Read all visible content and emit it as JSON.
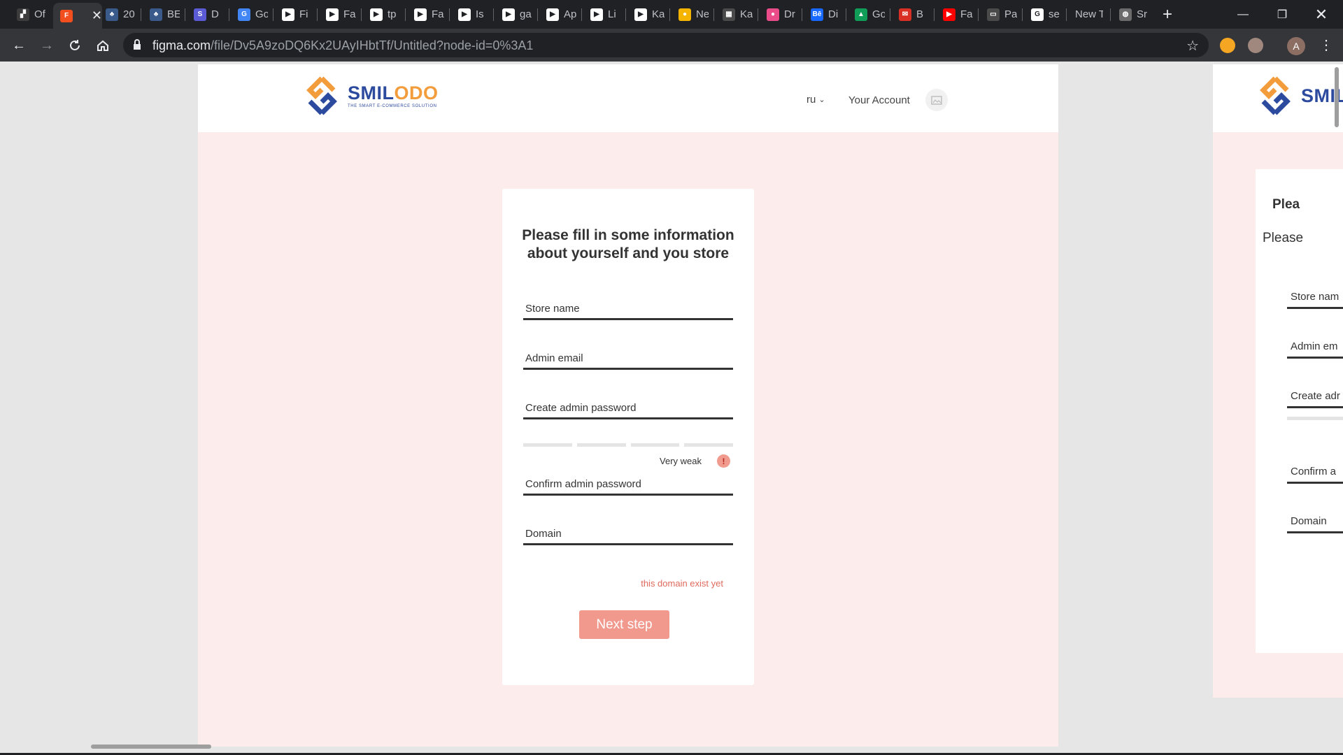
{
  "browser": {
    "tabs": [
      {
        "title": "Of",
        "fav_color": "#3c3c3c",
        "fav_glyph": "▞"
      },
      {
        "title": "",
        "fav_color": "#f24e1e",
        "fav_glyph": "F",
        "active": true
      },
      {
        "title": "20",
        "fav_color": "#3a5a8c",
        "fav_glyph": "♣"
      },
      {
        "title": "BE",
        "fav_color": "#3a5a8c",
        "fav_glyph": "♣"
      },
      {
        "title": "D",
        "fav_color": "#5b5bd6",
        "fav_glyph": "S"
      },
      {
        "title": "Go",
        "fav_color": "#4285f4",
        "fav_glyph": "G"
      },
      {
        "title": "Fi",
        "fav_color": "#ffffff",
        "fav_glyph": "▶"
      },
      {
        "title": "Fa",
        "fav_color": "#ffffff",
        "fav_glyph": "▶"
      },
      {
        "title": "tp",
        "fav_color": "#ffffff",
        "fav_glyph": "▶"
      },
      {
        "title": "Fa",
        "fav_color": "#ffffff",
        "fav_glyph": "▶"
      },
      {
        "title": "Is",
        "fav_color": "#ffffff",
        "fav_glyph": "▶"
      },
      {
        "title": "ga",
        "fav_color": "#ffffff",
        "fav_glyph": "▶"
      },
      {
        "title": "Ap",
        "fav_color": "#ffffff",
        "fav_glyph": "▶"
      },
      {
        "title": "Li",
        "fav_color": "#ffffff",
        "fav_glyph": "▶"
      },
      {
        "title": "Ka",
        "fav_color": "#ffffff",
        "fav_glyph": "▶"
      },
      {
        "title": "Ne",
        "fav_color": "#f4b400",
        "fav_glyph": "●"
      },
      {
        "title": "Ka",
        "fav_color": "#4a4a4a",
        "fav_glyph": "▦"
      },
      {
        "title": "Dr",
        "fav_color": "#ea4c89",
        "fav_glyph": "●"
      },
      {
        "title": "Di",
        "fav_color": "#1769ff",
        "fav_glyph": "Bē"
      },
      {
        "title": "Go",
        "fav_color": "#0f9d58",
        "fav_glyph": "▲"
      },
      {
        "title": "B",
        "fav_color": "#d93025",
        "fav_glyph": "✉"
      },
      {
        "title": "Fa",
        "fav_color": "#ff0000",
        "fav_glyph": "▶"
      },
      {
        "title": "Pa",
        "fav_color": "#4a4a4a",
        "fav_glyph": "▭"
      },
      {
        "title": "se",
        "fav_color": "#ffffff",
        "fav_glyph": "G"
      },
      {
        "title": "New T",
        "fav_color": "",
        "fav_glyph": ""
      },
      {
        "title": "Sr",
        "fav_color": "#6b6b6b",
        "fav_glyph": "◍"
      }
    ],
    "url_host": "figma.com",
    "url_path": "/file/Dv5A9zoDQ6Kx2UAyIHbtTf/Untitled?node-id=0%3A1",
    "profile_initial": "A"
  },
  "site": {
    "logo_part1": "SMIL",
    "logo_part2": "ODO",
    "logo_tagline": "THE SMART E-COMMERCE SOLUTION",
    "lang": "ru",
    "account_label": "Your Account"
  },
  "form": {
    "title": "Please fill in some information about yourself and you store",
    "store_name": "Store name",
    "admin_email": "Admin email",
    "create_password": "Create admin password",
    "strength": "Very weak",
    "confirm_password": "Confirm admin password",
    "domain": "Domain",
    "domain_error": "this domain exist yet",
    "next_button": "Next step"
  },
  "frame2": {
    "logo_part": "SMIL",
    "title_fragment": "Plea",
    "subtitle_fragment": "Please",
    "store_name": "Store nam",
    "admin_email": "Admin em",
    "create_password": "Create adr",
    "confirm_password": "Confirm a",
    "domain": "Domain"
  }
}
